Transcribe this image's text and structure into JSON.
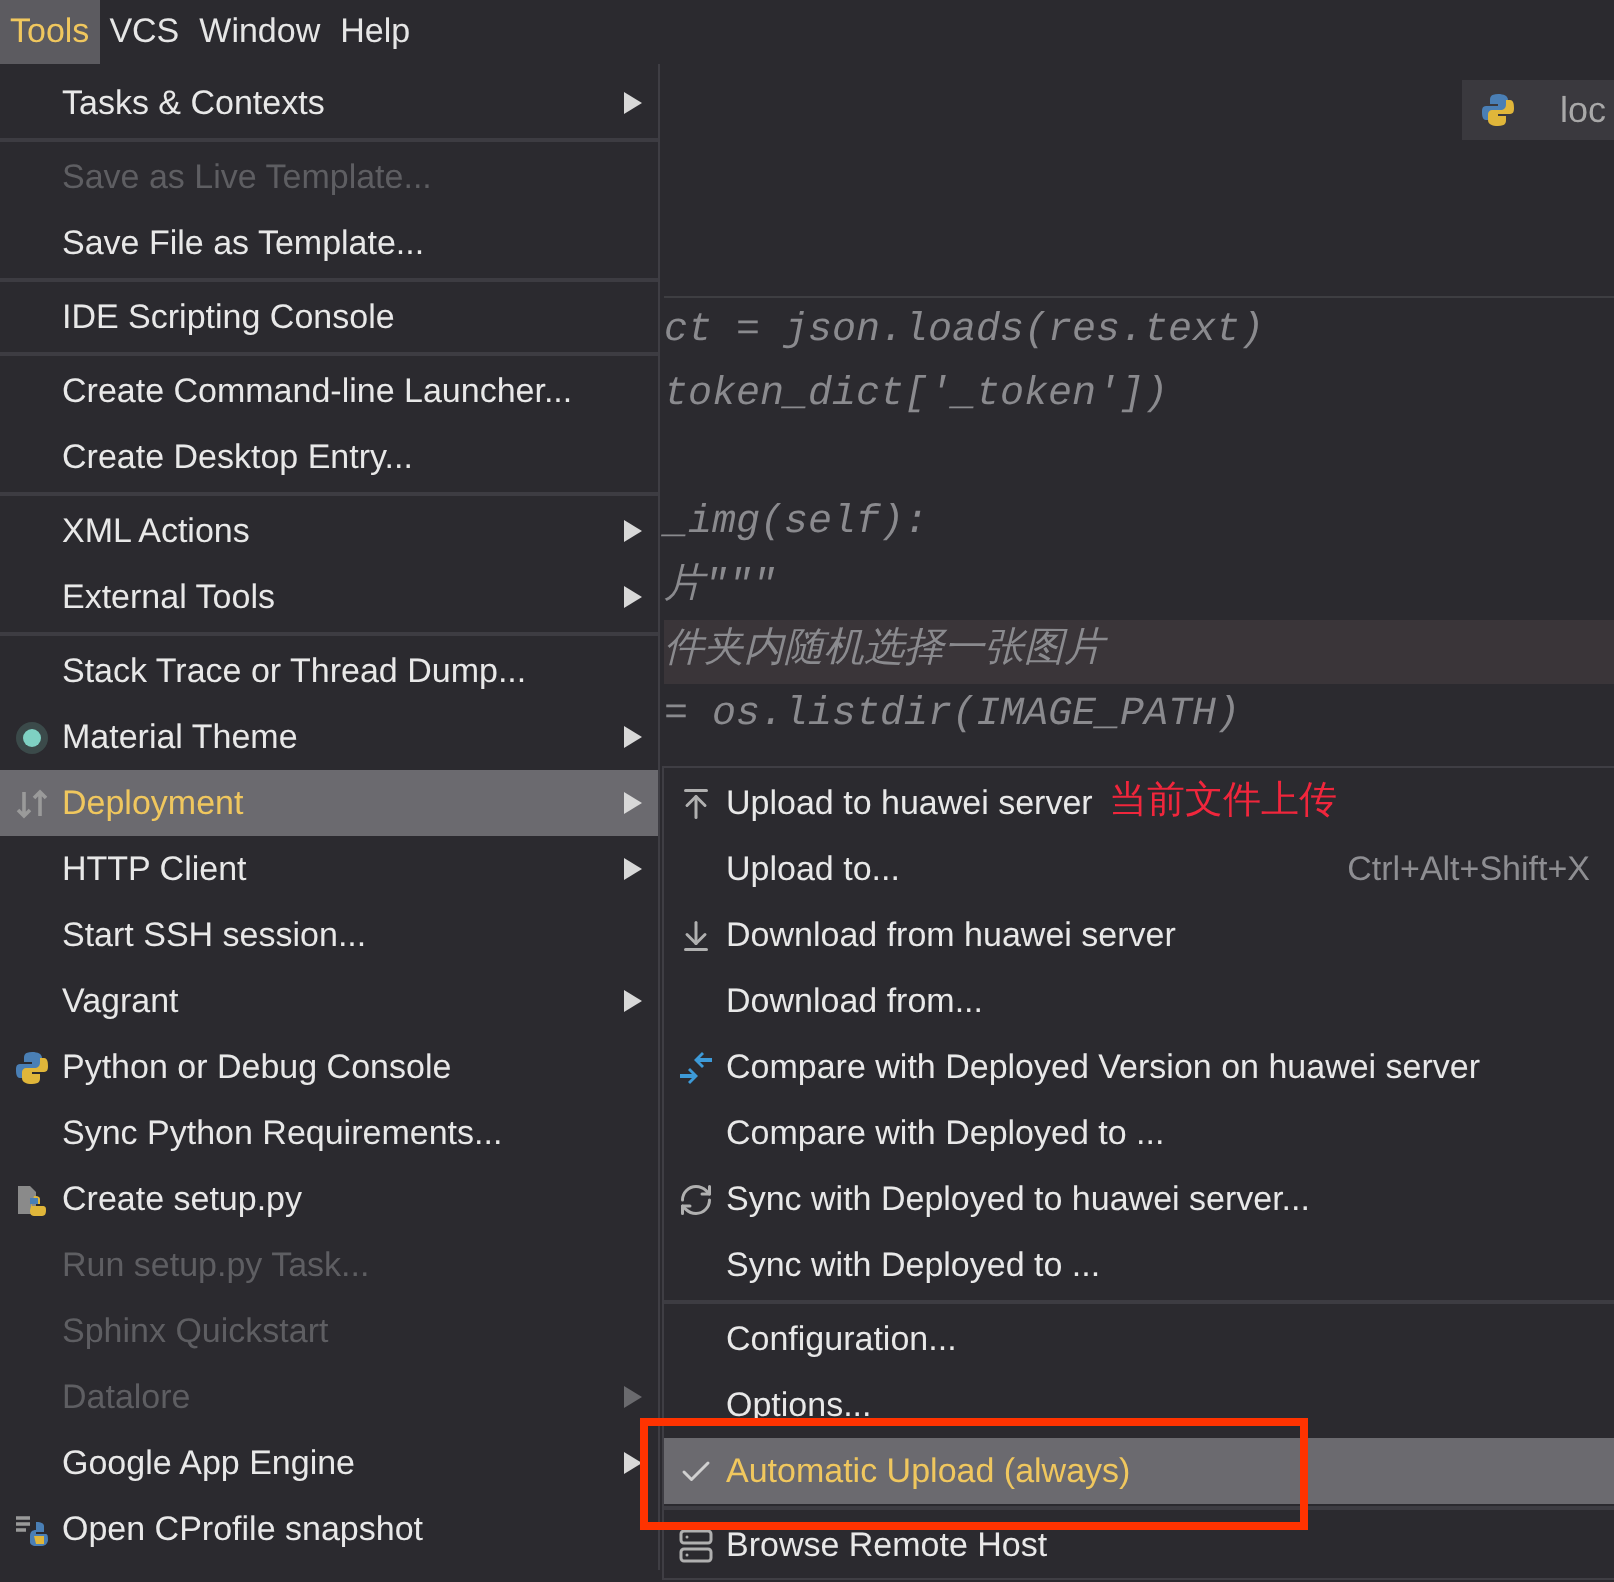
{
  "menubar": [
    {
      "label": "Tools",
      "selected": true
    },
    {
      "label": "VCS",
      "selected": false
    },
    {
      "label": "Window",
      "selected": false
    },
    {
      "label": "Help",
      "selected": false
    }
  ],
  "editor": {
    "tab": {
      "label": "loc"
    },
    "lines": [
      {
        "text": "ct = json.loads(res.text)",
        "highlighted": false
      },
      {
        "text": "token_dict['_token'])",
        "highlighted": false
      },
      {
        "highlighted": false
      },
      {
        "text": "_img(self):",
        "highlighted": false
      },
      {
        "text": "片\"\"\"",
        "highlighted": false
      },
      {
        "text": "件夹内随机选择一张图片",
        "highlighted": true
      },
      {
        "text": "= os.listdir(IMAGE_PATH)",
        "highlighted": false
      }
    ]
  },
  "tools_menu": {
    "items": [
      {
        "kind": "item",
        "label": "Tasks & Contexts",
        "disabled": false,
        "submenu": true,
        "selected": false
      },
      {
        "kind": "separator"
      },
      {
        "kind": "item",
        "label": "Save as Live Template...",
        "disabled": true,
        "submenu": false,
        "selected": false
      },
      {
        "kind": "item",
        "label": "Save File as Template...",
        "disabled": false,
        "submenu": false,
        "selected": false
      },
      {
        "kind": "separator"
      },
      {
        "kind": "item",
        "label": "IDE Scripting Console",
        "disabled": false,
        "submenu": false,
        "selected": false
      },
      {
        "kind": "separator"
      },
      {
        "kind": "item",
        "label": "Create Command-line Launcher...",
        "disabled": false,
        "submenu": false,
        "selected": false
      },
      {
        "kind": "item",
        "label": "Create Desktop Entry...",
        "disabled": false,
        "submenu": false,
        "selected": false
      },
      {
        "kind": "separator"
      },
      {
        "kind": "item",
        "label": "XML Actions",
        "disabled": false,
        "submenu": true,
        "selected": false
      },
      {
        "kind": "item",
        "label": "External Tools",
        "disabled": false,
        "submenu": true,
        "selected": false
      },
      {
        "kind": "separator"
      },
      {
        "kind": "item",
        "label": "Stack Trace or Thread Dump...",
        "disabled": false,
        "submenu": false,
        "selected": false
      },
      {
        "kind": "item",
        "label": "Material Theme",
        "disabled": false,
        "submenu": true,
        "selected": false
      },
      {
        "kind": "item",
        "label": "Deployment",
        "disabled": false,
        "submenu": true,
        "selected": true
      },
      {
        "kind": "item",
        "label": "HTTP Client",
        "disabled": false,
        "submenu": true,
        "selected": false
      },
      {
        "kind": "item",
        "label": "Start SSH session...",
        "disabled": false,
        "submenu": false,
        "selected": false
      },
      {
        "kind": "item",
        "label": "Vagrant",
        "disabled": false,
        "submenu": true,
        "selected": false
      },
      {
        "kind": "item",
        "label": "Python or Debug Console",
        "disabled": false,
        "submenu": false,
        "selected": false
      },
      {
        "kind": "item",
        "label": "Sync Python Requirements...",
        "disabled": false,
        "submenu": false,
        "selected": false
      },
      {
        "kind": "item",
        "label": "Create setup.py",
        "disabled": false,
        "submenu": false,
        "selected": false
      },
      {
        "kind": "item",
        "label": "Run setup.py Task...",
        "disabled": true,
        "submenu": false,
        "selected": false
      },
      {
        "kind": "item",
        "label": "Sphinx Quickstart",
        "disabled": true,
        "submenu": false,
        "selected": false
      },
      {
        "kind": "item",
        "label": "Datalore",
        "disabled": true,
        "submenu": true,
        "selected": false
      },
      {
        "kind": "item",
        "label": "Google App Engine",
        "disabled": false,
        "submenu": true,
        "selected": false
      },
      {
        "kind": "item",
        "label": "Open CProfile snapshot",
        "disabled": false,
        "submenu": false,
        "selected": false
      }
    ]
  },
  "deployment_menu": {
    "items": [
      {
        "kind": "item",
        "label": "Upload to huawei server",
        "note": "当前文件上传",
        "selected": false,
        "checked": false
      },
      {
        "kind": "item",
        "label": "Upload to...",
        "shortcut": "Ctrl+Alt+Shift+X",
        "selected": false,
        "checked": false
      },
      {
        "kind": "item",
        "label": "Download from huawei server",
        "selected": false,
        "checked": false
      },
      {
        "kind": "item",
        "label": "Download from...",
        "selected": false,
        "checked": false
      },
      {
        "kind": "item",
        "label": "Compare with Deployed Version on huawei server",
        "selected": false,
        "checked": false
      },
      {
        "kind": "item",
        "label": "Compare with Deployed to ...",
        "selected": false,
        "checked": false
      },
      {
        "kind": "item",
        "label": "Sync with Deployed to huawei server...",
        "selected": false,
        "checked": false
      },
      {
        "kind": "item",
        "label": "Sync with Deployed to ...",
        "selected": false,
        "checked": false
      },
      {
        "kind": "separator"
      },
      {
        "kind": "item",
        "label": "Configuration...",
        "selected": false,
        "checked": false
      },
      {
        "kind": "item",
        "label": "Options...",
        "selected": false,
        "checked": false
      },
      {
        "kind": "item",
        "label": "Automatic Upload (always)",
        "selected": true,
        "checked": true,
        "annotated": true
      },
      {
        "kind": "separator"
      },
      {
        "kind": "item",
        "label": "Browse Remote Host",
        "selected": false,
        "checked": false
      }
    ]
  }
}
